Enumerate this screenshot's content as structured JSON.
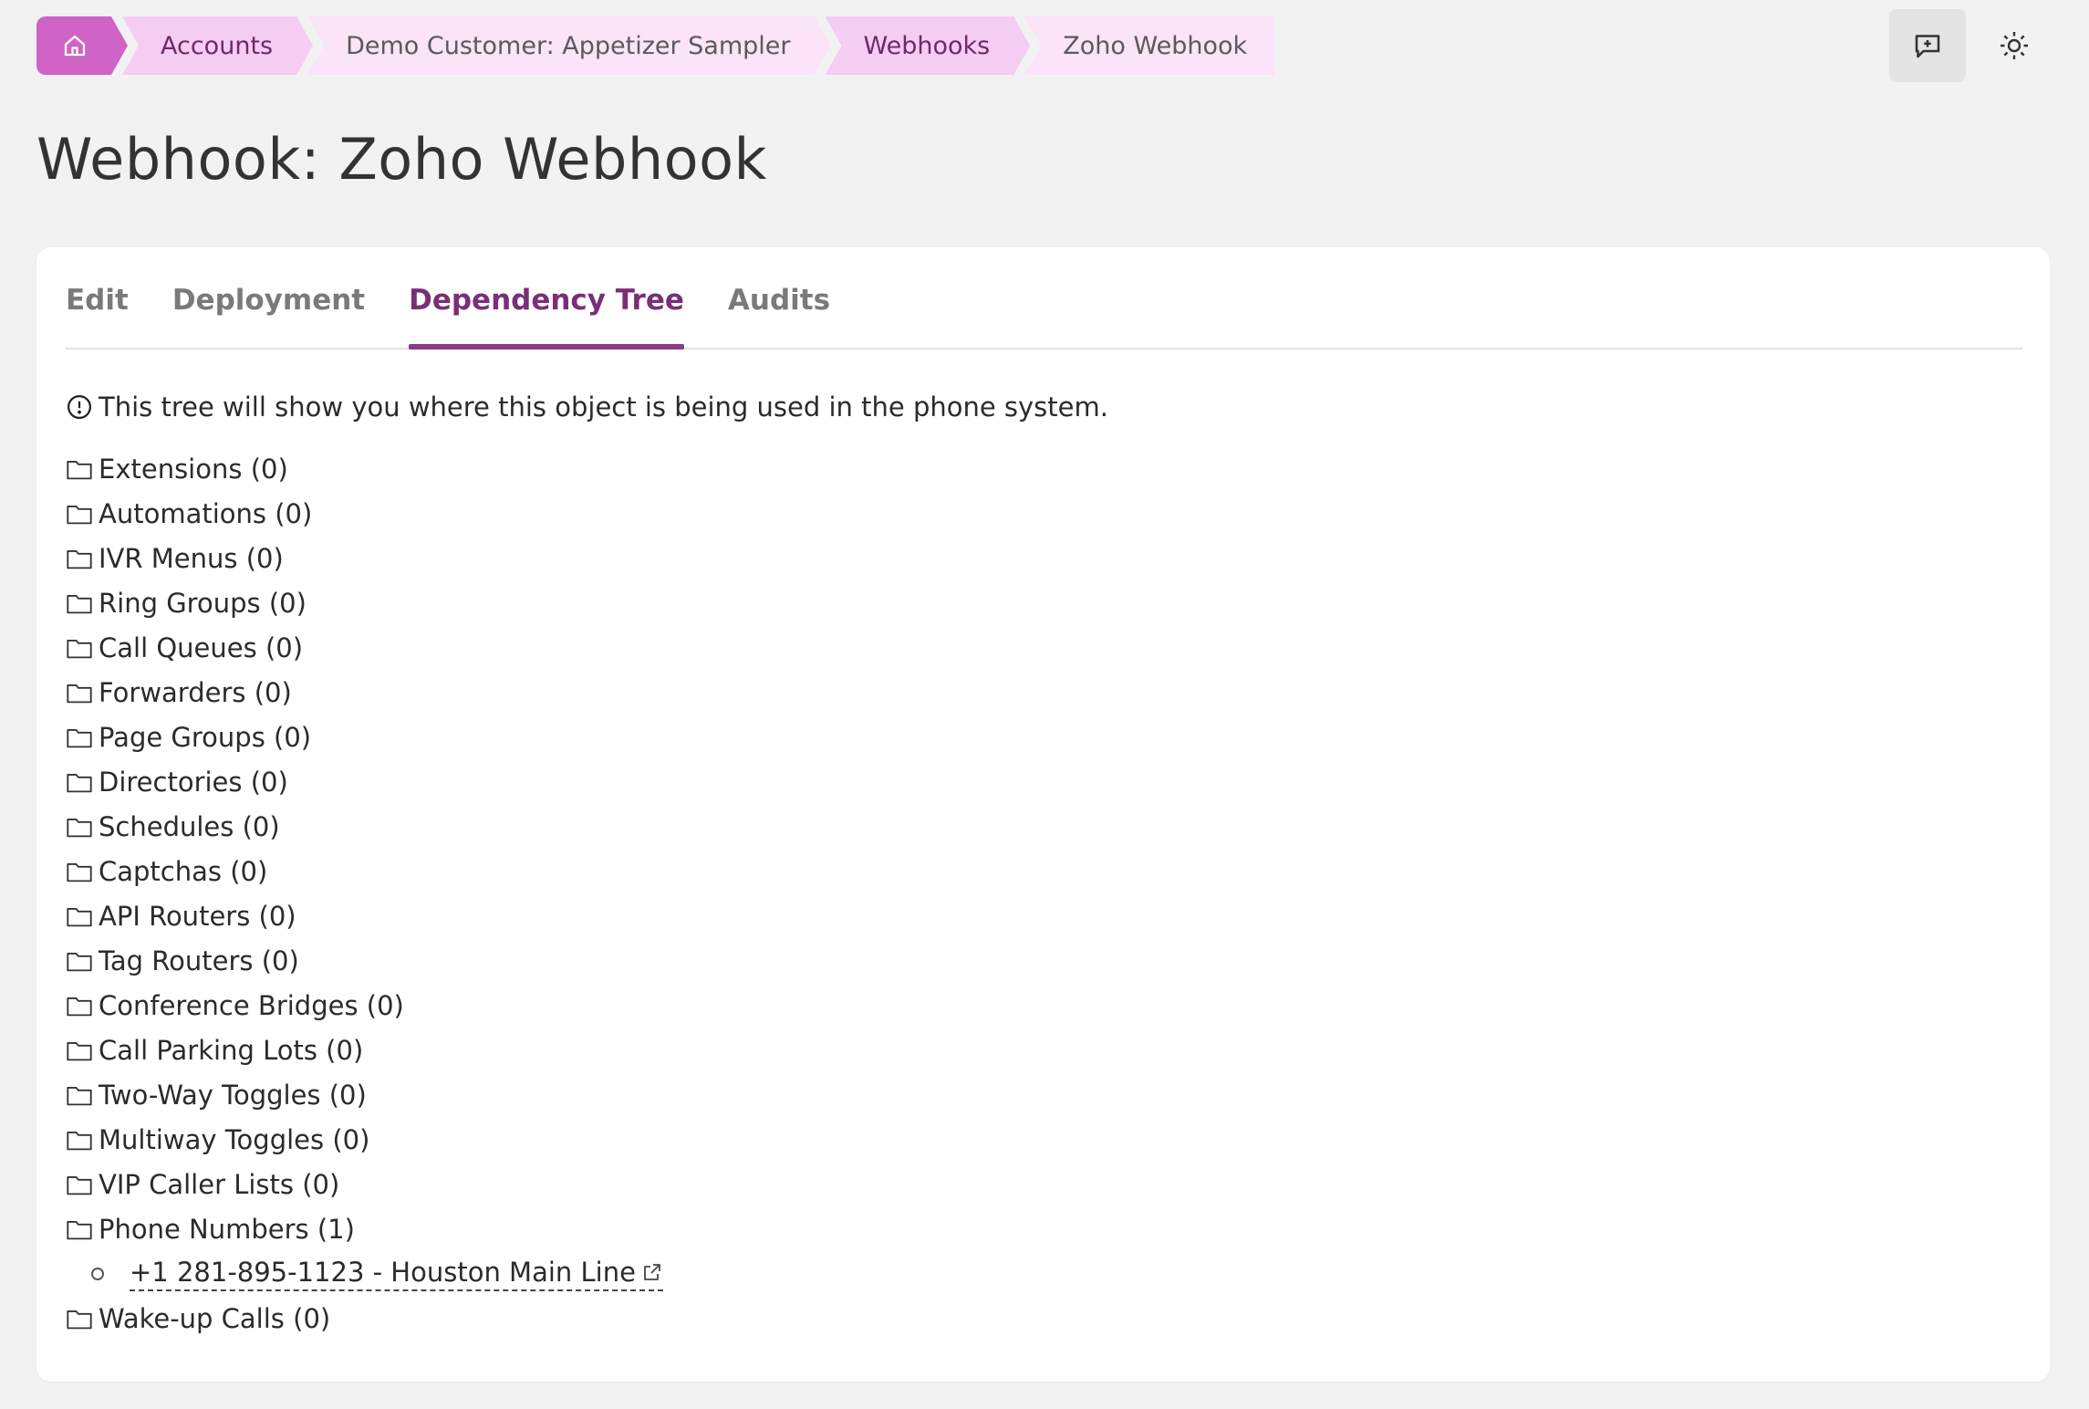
{
  "breadcrumb": {
    "items": [
      "Accounts",
      "Demo Customer: Appetizer Sampler",
      "Webhooks",
      "Zoho Webhook"
    ]
  },
  "page": {
    "title": "Webhook: Zoho Webhook"
  },
  "tabs": [
    {
      "label": "Edit",
      "active": false
    },
    {
      "label": "Deployment",
      "active": false
    },
    {
      "label": "Dependency Tree",
      "active": true
    },
    {
      "label": "Audits",
      "active": false
    }
  ],
  "info_text": "This tree will show you where this object is being used in the phone system.",
  "tree": [
    "Extensions (0)",
    "Automations (0)",
    "IVR Menus (0)",
    "Ring Groups (0)",
    "Call Queues (0)",
    "Forwarders (0)",
    "Page Groups (0)",
    "Directories (0)",
    "Schedules (0)",
    "Captchas (0)",
    "API Routers (0)",
    "Tag Routers (0)",
    "Conference Bridges (0)",
    "Call Parking Lots (0)",
    "Two-Way Toggles (0)",
    "Multiway Toggles (0)",
    "VIP Caller Lists (0)",
    "Phone Numbers (1)",
    "Wake-up Calls (0)"
  ],
  "phone_number_link": "+1 281-895-1123 - Houston Main Line",
  "colors": {
    "accent": "#8b3a88",
    "home": "#cf64c6",
    "crumb": "#f6cdf2"
  },
  "icons": {
    "home": "home-icon",
    "feedback": "feedback-icon",
    "theme": "sun-icon",
    "folder": "folder-icon",
    "info": "info-icon",
    "external": "external-link-icon"
  }
}
